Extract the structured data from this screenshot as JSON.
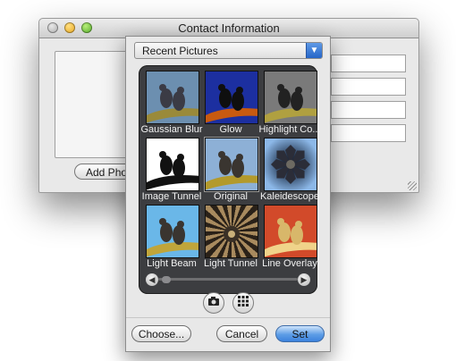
{
  "window": {
    "title": "Contact Information",
    "add_photo_label": "Add Photo"
  },
  "picker": {
    "source_popup": "Recent Pictures",
    "effects": [
      {
        "label": "Gaussian Blur",
        "style": "blur",
        "selected": false
      },
      {
        "label": "Glow",
        "style": "glow",
        "selected": false
      },
      {
        "label": "Highlight Co...",
        "style": "highlight",
        "selected": false
      },
      {
        "label": "Image Tunnel",
        "style": "tunnel",
        "selected": false
      },
      {
        "label": "Original",
        "style": "original",
        "selected": true
      },
      {
        "label": "Kaleidescope",
        "style": "kaleido",
        "selected": false
      },
      {
        "label": "Light Beam",
        "style": "beam",
        "selected": false
      },
      {
        "label": "Light Tunnel",
        "style": "lighttunnel",
        "selected": false
      },
      {
        "label": "Line Overlay",
        "style": "lineoverlay",
        "selected": false
      }
    ],
    "camera_icon": "camera-icon",
    "effects_icon": "grid-icon",
    "choose_label": "Choose...",
    "cancel_label": "Cancel",
    "set_label": "Set"
  },
  "colors": {
    "accent_blue": "#3c82dd",
    "browser_bg": "#3c3d40"
  }
}
